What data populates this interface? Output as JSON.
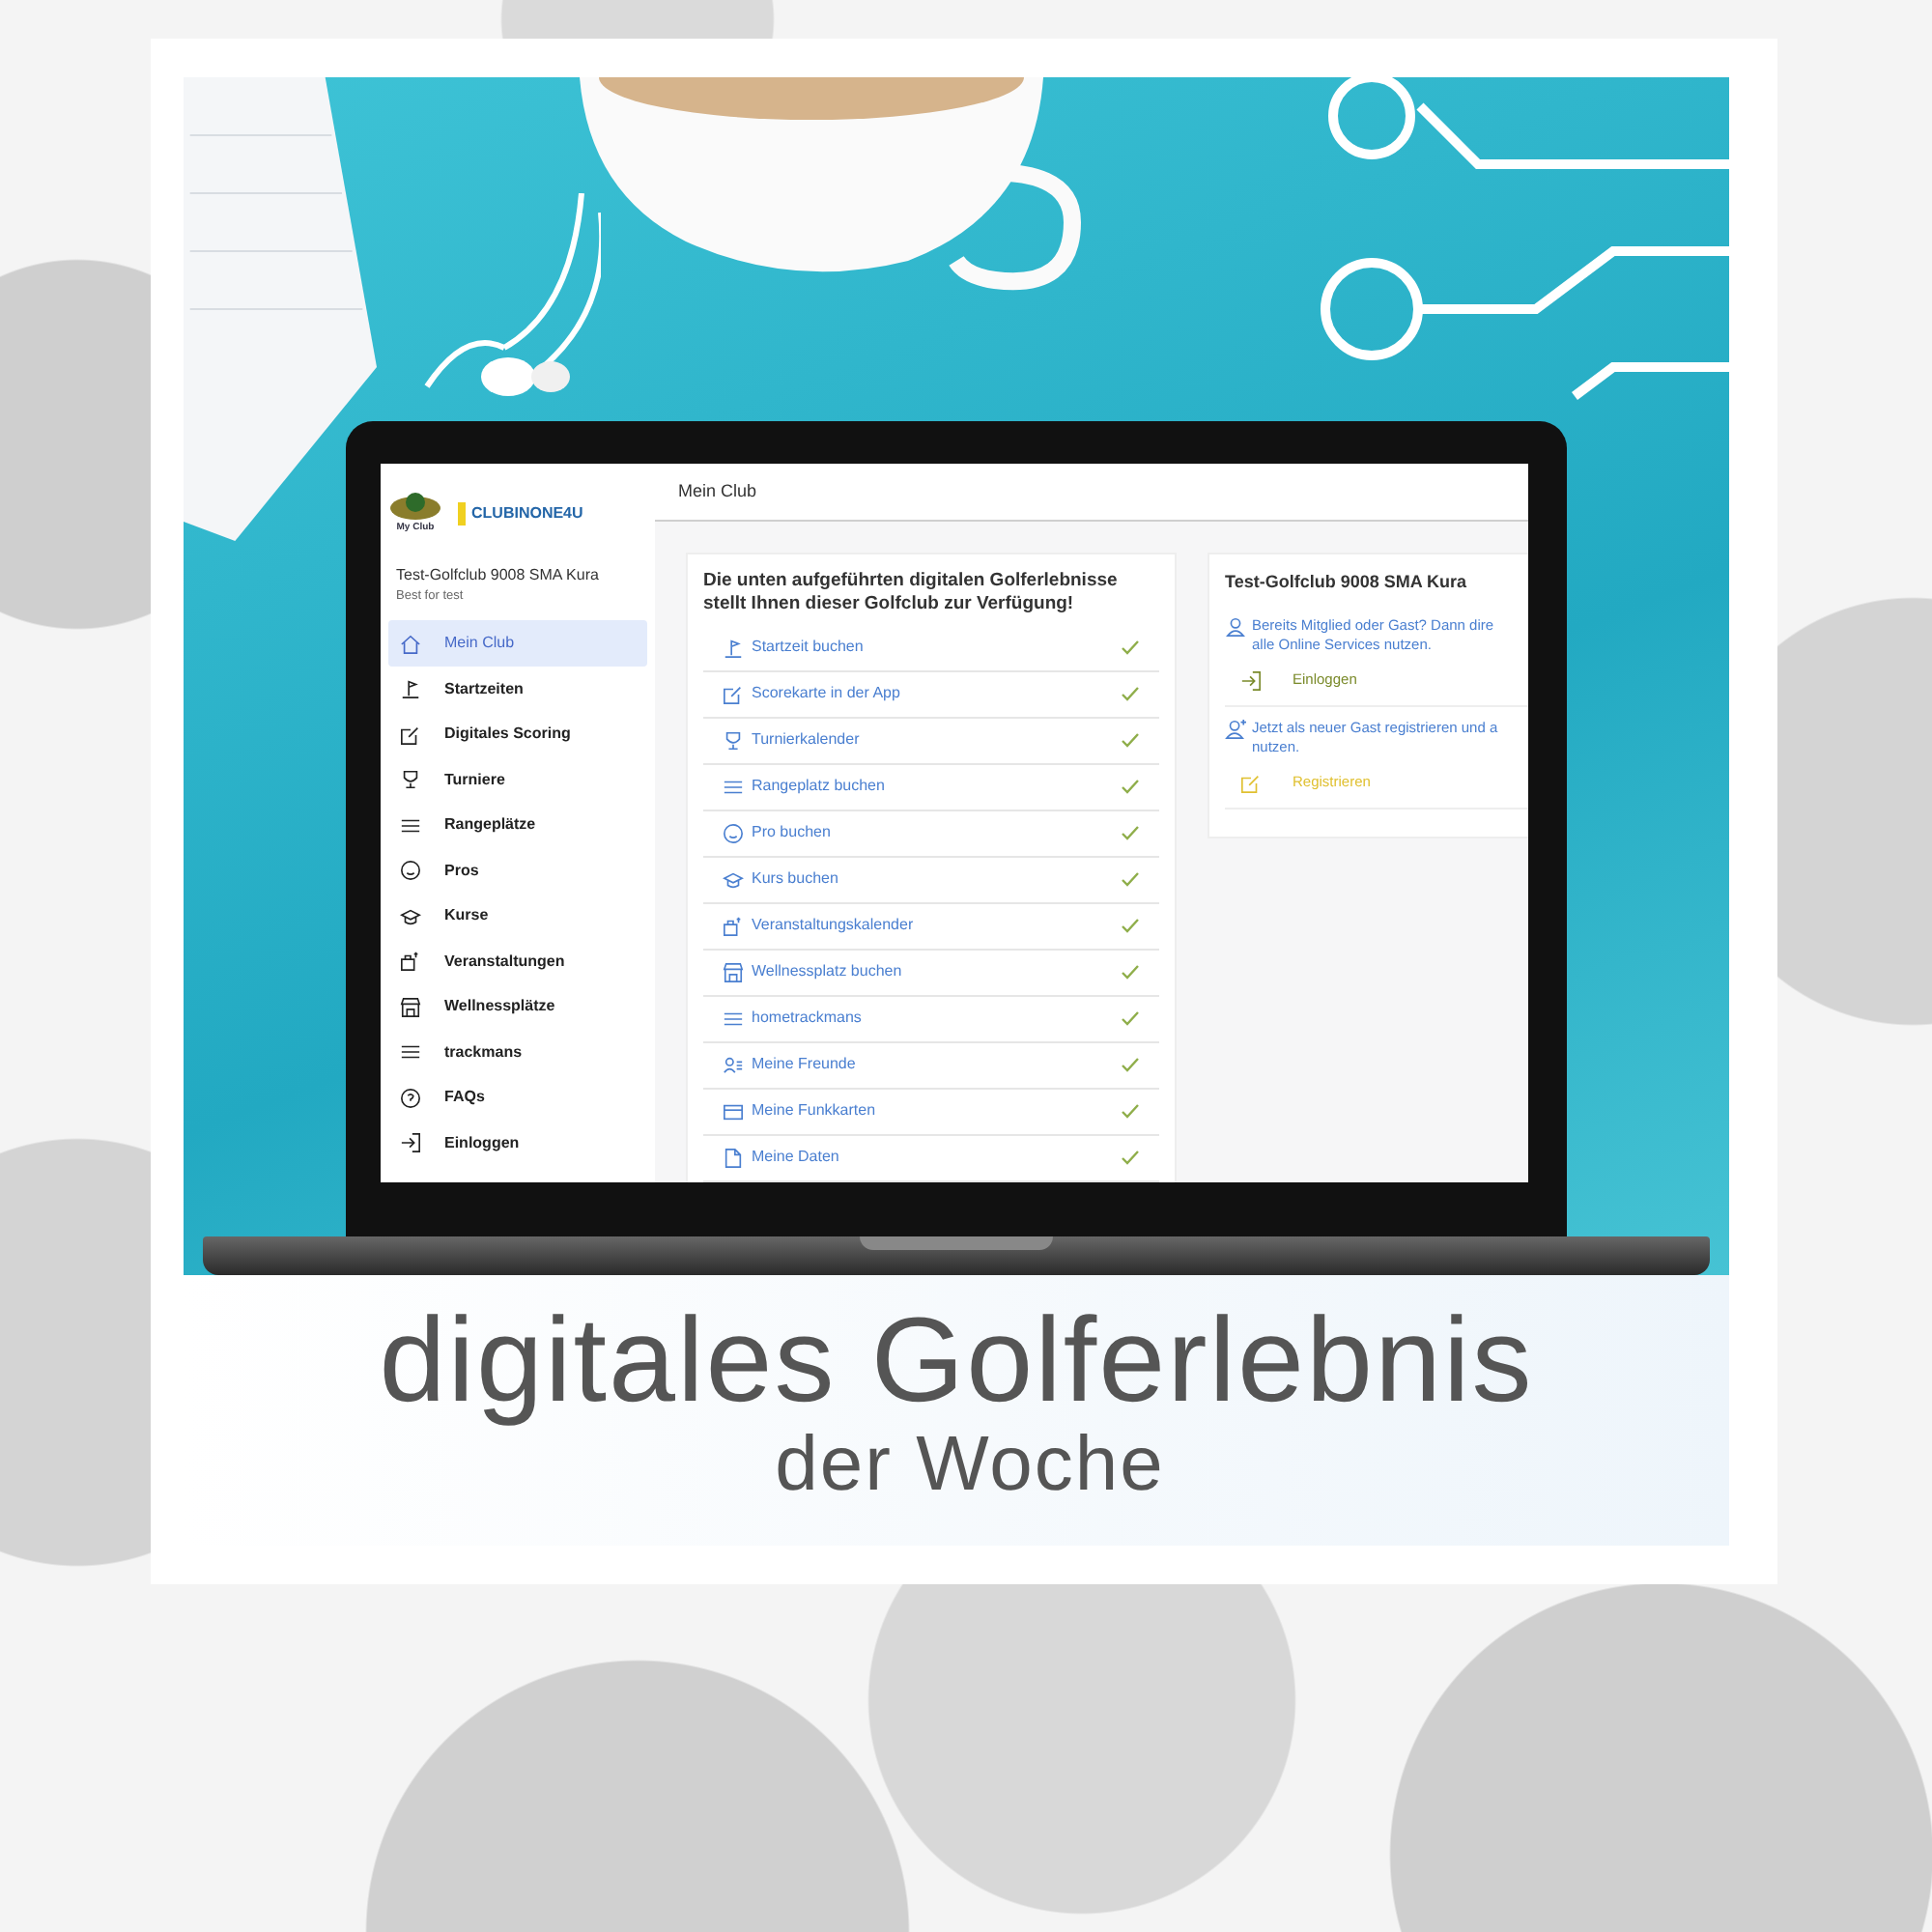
{
  "app": {
    "logo": {
      "badge_text": "My Club",
      "brand": "CLUBINONE4U"
    },
    "club": {
      "name": "Test-Golfclub 9008 SMA Kura",
      "tagline": "Best for test"
    },
    "sidebar": {
      "items": [
        {
          "label": "Mein Club",
          "kind": "home",
          "selected": true
        },
        {
          "label": "Startzeiten",
          "kind": "flag",
          "selected": false
        },
        {
          "label": "Digitales Scoring",
          "kind": "edit",
          "selected": false
        },
        {
          "label": "Turniere",
          "kind": "trophy",
          "selected": false
        },
        {
          "label": "Rangeplätze",
          "kind": "list",
          "selected": false
        },
        {
          "label": "Pros",
          "kind": "face",
          "selected": false
        },
        {
          "label": "Kurse",
          "kind": "cap",
          "selected": false
        },
        {
          "label": "Veranstaltungen",
          "kind": "building",
          "selected": false
        },
        {
          "label": "Wellnessplätze",
          "kind": "store",
          "selected": false
        },
        {
          "label": "trackmans",
          "kind": "list",
          "selected": false
        },
        {
          "label": "FAQs",
          "kind": "help",
          "selected": false
        },
        {
          "label": "Einloggen",
          "kind": "login",
          "selected": false
        }
      ]
    },
    "page_title": "Mein Club",
    "services": {
      "heading": "Die unten aufgeführten digitalen Golferlebnisse stellt Ihnen dieser Golfclub zur Verfügung!",
      "items": [
        {
          "label": "Startzeit buchen",
          "kind": "flag",
          "available": true
        },
        {
          "label": "Scorekarte in der App",
          "kind": "edit",
          "available": true
        },
        {
          "label": "Turnierkalender",
          "kind": "trophy",
          "available": true
        },
        {
          "label": "Rangeplatz buchen",
          "kind": "list",
          "available": true
        },
        {
          "label": "Pro buchen",
          "kind": "face",
          "available": true
        },
        {
          "label": "Kurs buchen",
          "kind": "cap",
          "available": true
        },
        {
          "label": "Veranstaltungskalender",
          "kind": "building",
          "available": true
        },
        {
          "label": "Wellnessplatz buchen",
          "kind": "store",
          "available": true
        },
        {
          "label": "hometrackmans",
          "kind": "list",
          "available": true
        },
        {
          "label": "Meine Freunde",
          "kind": "friends",
          "available": true
        },
        {
          "label": "Meine Funkkarten",
          "kind": "card",
          "available": true
        },
        {
          "label": "Meine Daten",
          "kind": "file",
          "available": true
        }
      ]
    },
    "account": {
      "title": "Test-Golfclub 9008 SMA Kura",
      "sections": [
        {
          "kind": "user",
          "lines": [
            "Bereits Mitglied oder Gast? Dann dire",
            "alle Online Services nutzen."
          ],
          "action": {
            "label": "Einloggen",
            "kind": "login",
            "color": "#7a8a2a"
          }
        },
        {
          "kind": "user-add",
          "lines": [
            "Jetzt als neuer Gast registrieren und a",
            "nutzen."
          ],
          "action": {
            "label": "Registrieren",
            "kind": "edit",
            "color": "#e0c030"
          }
        }
      ]
    }
  },
  "caption": {
    "title": "digitales Golferlebnis",
    "subtitle": "der Woche"
  }
}
